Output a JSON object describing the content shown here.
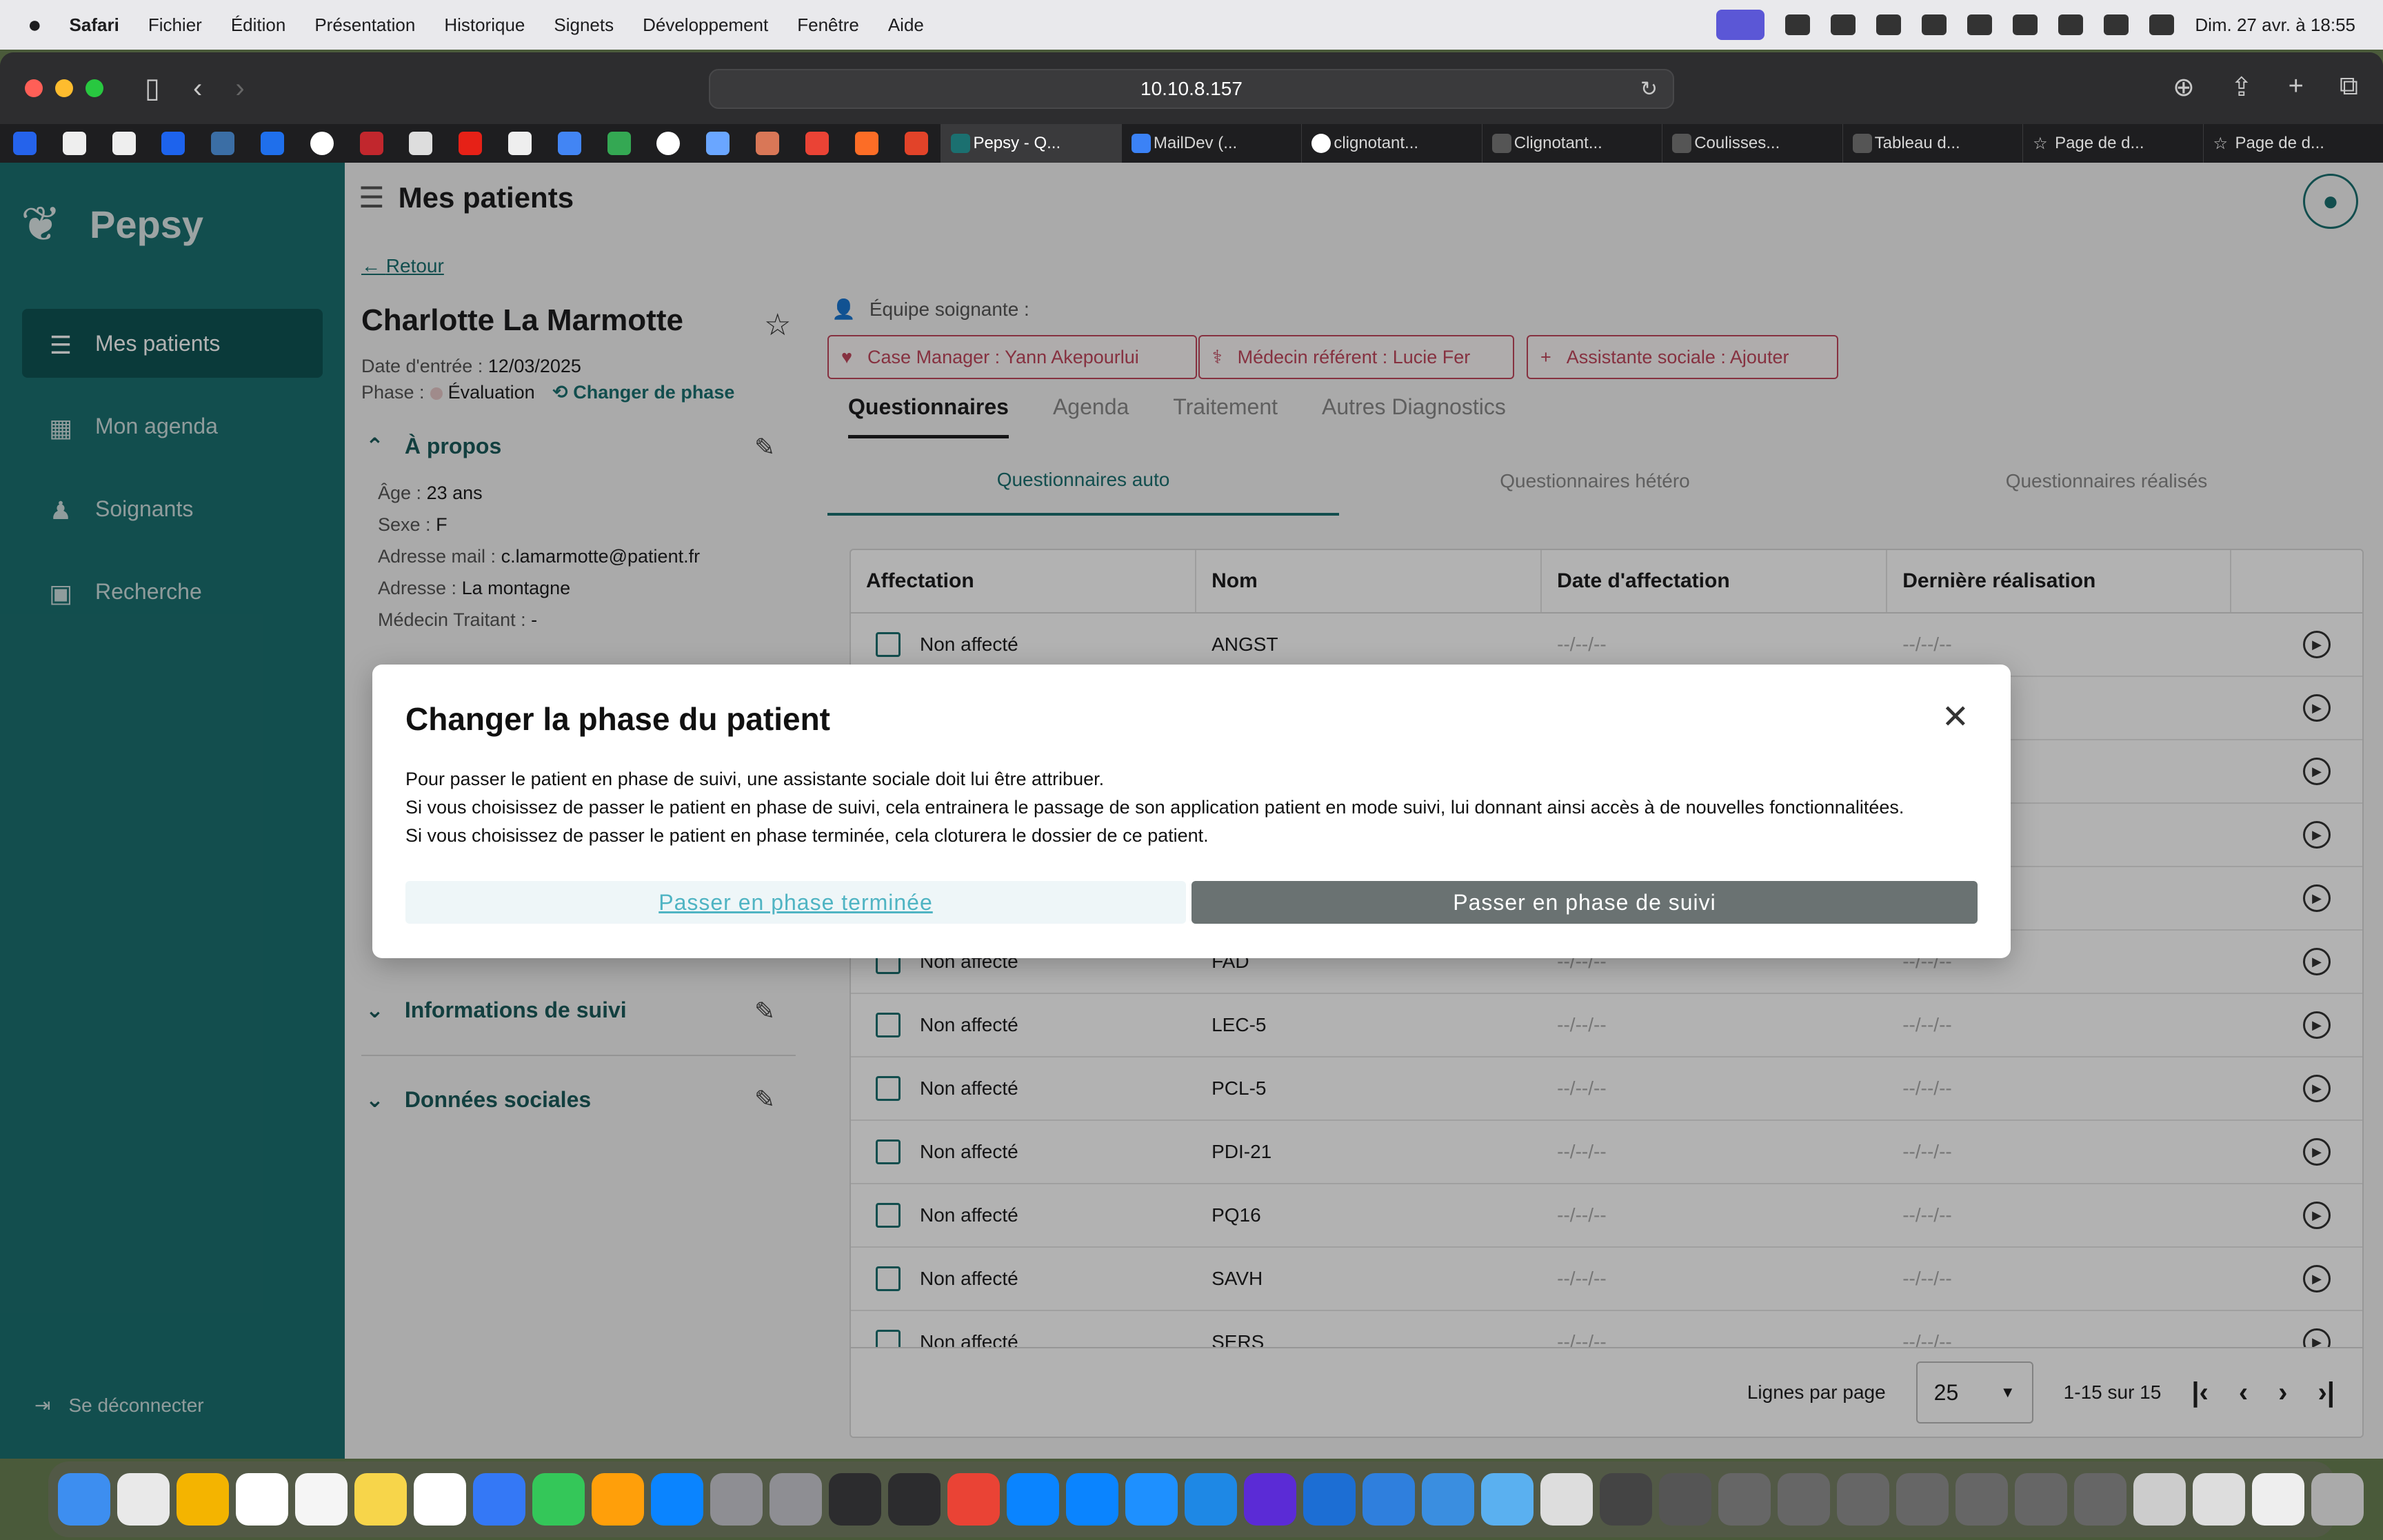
{
  "menubar": {
    "apple": "",
    "items": [
      "Safari",
      "Fichier",
      "Édition",
      "Présentation",
      "Historique",
      "Signets",
      "Développement",
      "Fenêtre",
      "Aide"
    ],
    "clock": "Dim. 27 avr. à 18:55"
  },
  "browser": {
    "url": "10.10.8.157",
    "tabs": [
      {
        "label": "Pepsy - Q..."
      },
      {
        "label": "MailDev (..."
      },
      {
        "label": "clignotant..."
      },
      {
        "label": "Clignotant..."
      },
      {
        "label": "Coulisses..."
      },
      {
        "label": "Tableau d..."
      },
      {
        "label": "Page de d..."
      },
      {
        "label": "Page de d..."
      }
    ]
  },
  "sidebar": {
    "brand": "Pepsy",
    "items": [
      {
        "label": "Mes patients"
      },
      {
        "label": "Mon agenda"
      },
      {
        "label": "Soignants"
      },
      {
        "label": "Recherche"
      }
    ],
    "logout": "Se déconnecter"
  },
  "header": {
    "title": "Mes patients"
  },
  "patient": {
    "back": "Retour",
    "name": "Charlotte La Marmotte",
    "entry_label": "Date d'entrée :",
    "entry_date": "12/03/2025",
    "phase_label": "Phase :",
    "phase_value": "Évaluation",
    "change_phase": "Changer de phase",
    "about_title": "À propos",
    "age_label": "Âge :",
    "age": "23 ans",
    "sex_label": "Sexe :",
    "sex": "F",
    "mail_label": "Adresse mail :",
    "mail": "c.lamarmotte@patient.fr",
    "address_label": "Adresse :",
    "address": "La montagne",
    "doctor_label": "Médecin Traitant :",
    "doctor": "-",
    "followup_title": "Informations de suivi",
    "social_title": "Données sociales"
  },
  "team": {
    "label": "Équipe soignante :",
    "case_manager": "Case Manager : Yann Akepourlui",
    "referent": "Médecin référent : Lucie Fer",
    "social": "Assistante sociale : Ajouter"
  },
  "tabs": [
    "Questionnaires",
    "Agenda",
    "Traitement",
    "Autres Diagnostics"
  ],
  "subtabs": [
    "Questionnaires auto",
    "Questionnaires hétéro",
    "Questionnaires réalisés"
  ],
  "table": {
    "headers": [
      "Affectation",
      "Nom",
      "Date d'affectation",
      "Dernière réalisation"
    ],
    "rows": [
      {
        "status": "Non affecté",
        "name": "ANGST",
        "date": "--/--/--",
        "last": "--/--/--"
      },
      {
        "status": "",
        "name": "",
        "date": "",
        "last": ""
      },
      {
        "status": "",
        "name": "",
        "date": "",
        "last": ""
      },
      {
        "status": "",
        "name": "",
        "date": "",
        "last": ""
      },
      {
        "status": "",
        "name": "",
        "date": "",
        "last": ""
      },
      {
        "status": "Non affecté",
        "name": "FAD",
        "date": "--/--/--",
        "last": "--/--/--"
      },
      {
        "status": "Non affecté",
        "name": "LEC-5",
        "date": "--/--/--",
        "last": "--/--/--"
      },
      {
        "status": "Non affecté",
        "name": "PCL-5",
        "date": "--/--/--",
        "last": "--/--/--"
      },
      {
        "status": "Non affecté",
        "name": "PDI-21",
        "date": "--/--/--",
        "last": "--/--/--"
      },
      {
        "status": "Non affecté",
        "name": "PQ16",
        "date": "--/--/--",
        "last": "--/--/--"
      },
      {
        "status": "Non affecté",
        "name": "SAVH",
        "date": "--/--/--",
        "last": "--/--/--"
      },
      {
        "status": "Non affecté",
        "name": "SERS",
        "date": "--/--/--",
        "last": "--/--/--"
      }
    ],
    "pagination": {
      "rows_label": "Lignes par page",
      "per_page": "25",
      "range": "1-15 sur 15"
    }
  },
  "dialog": {
    "title": "Changer la phase du patient",
    "line1": "Pour passer le patient en phase de suivi, une assistante sociale doit lui être attribuer.",
    "line2": "Si vous choisissez de passer le patient en phase de suivi, cela entrainera le passage de son application patient en mode suivi, lui donnant ainsi accès à de nouvelles fonctionnalitées.",
    "line3": "Si vous choisissez de passer le patient en phase terminée, cela cloturera le dossier de ce patient.",
    "secondary": "Passer en phase terminée",
    "primary": "Passer en phase de suivi"
  },
  "colors": {
    "brand": "#1b7070",
    "chip": "#c0475c",
    "primary_button": "#6a7272",
    "ghost_text": "#4fb4c3"
  }
}
